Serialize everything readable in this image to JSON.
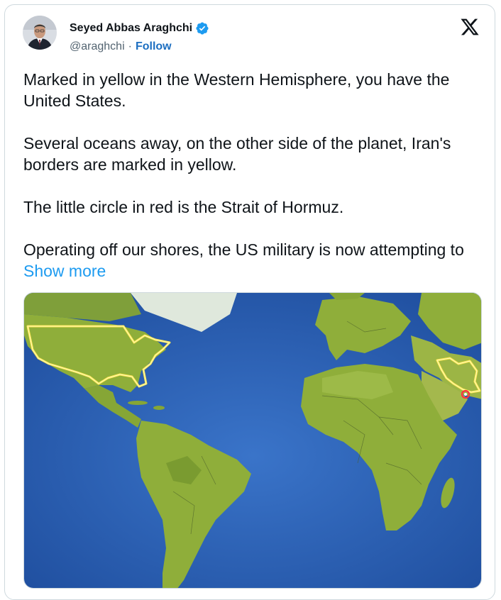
{
  "author": {
    "name": "Seyed Abbas Araghchi",
    "handle": "@araghchi",
    "separator": "·",
    "follow_label": "Follow",
    "verified": true
  },
  "icons": {
    "avatar": "avatar",
    "verified": "verified-badge-icon",
    "platform": "x-logo-icon"
  },
  "tweet": {
    "paragraphs": [
      "Marked in yellow in the Western Hemisphere, you have the United States.",
      "Several oceans away, on the other side of the planet, Iran's borders are marked in yellow.",
      "The little circle in red is the Strait of Hormuz."
    ],
    "last_paragraph": "Operating off our shores, the US military is now attempting to",
    "show_more_label": "Show more"
  },
  "media": {
    "type": "world-map-image",
    "highlight_color": "#ffe84d",
    "circle_color": "#ff3040"
  },
  "colors": {
    "link": "#1d9bf0",
    "follow": "#1d6fc1",
    "verified": "#1d9bf0",
    "ocean": "#2d5fb8",
    "land": "#8fae3a"
  }
}
